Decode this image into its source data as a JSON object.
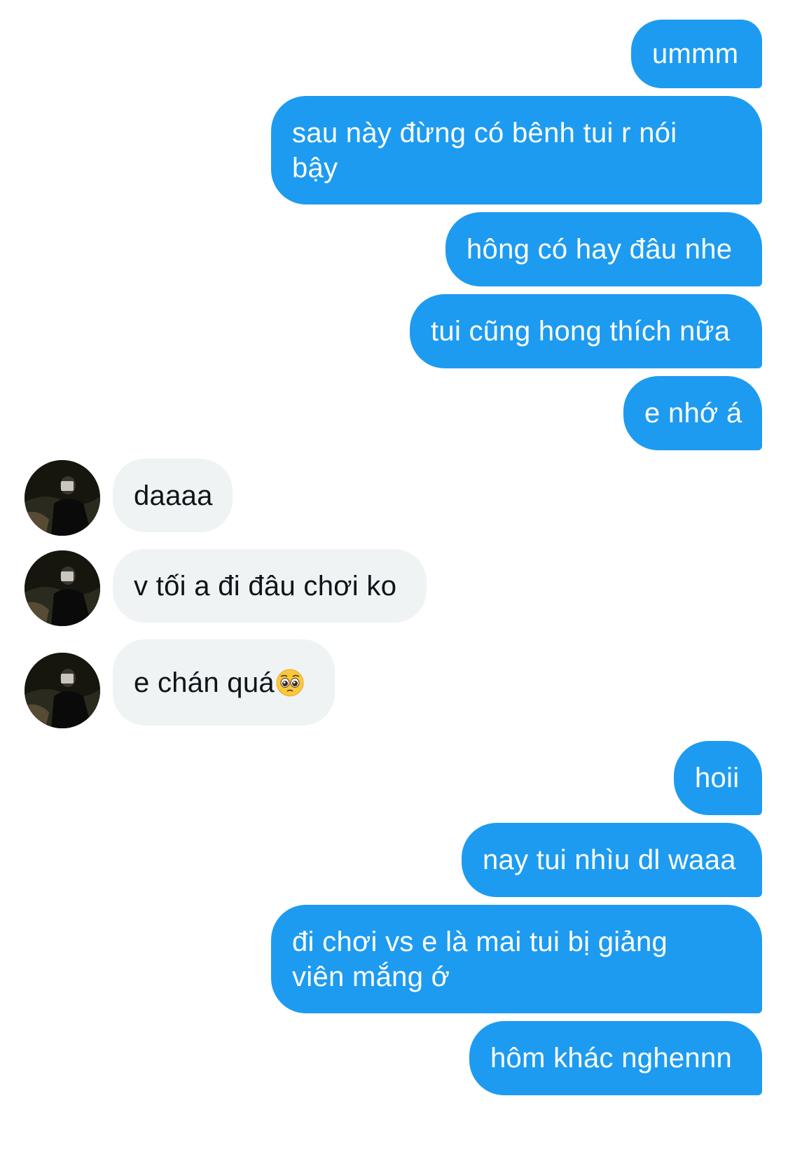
{
  "colors": {
    "sent_bubble": "#1d9bf0",
    "received_bubble": "#eff3f4",
    "sent_text": "#ffffff",
    "received_text": "#0f1419"
  },
  "messages": [
    {
      "from": "me",
      "text": "ummm"
    },
    {
      "from": "me",
      "text": "sau này đừng có bênh tui r nói bậy"
    },
    {
      "from": "me",
      "text": "hông có hay đâu nhe"
    },
    {
      "from": "me",
      "text": "tui cũng hong thích nữa"
    },
    {
      "from": "me",
      "text": "e nhớ á"
    },
    {
      "from": "them",
      "text": "daaaa"
    },
    {
      "from": "them",
      "text": "v tối a đi đâu chơi ko"
    },
    {
      "from": "them",
      "text": "e chán quá",
      "emoji": "pleading-face"
    },
    {
      "from": "me",
      "text": "hoii"
    },
    {
      "from": "me",
      "text": "nay tui nhìu dl waaa"
    },
    {
      "from": "me",
      "text": "đi chơi vs e là mai tui bị giảng viên mắng ớ"
    },
    {
      "from": "me",
      "text": "hôm khác nghennn"
    }
  ]
}
